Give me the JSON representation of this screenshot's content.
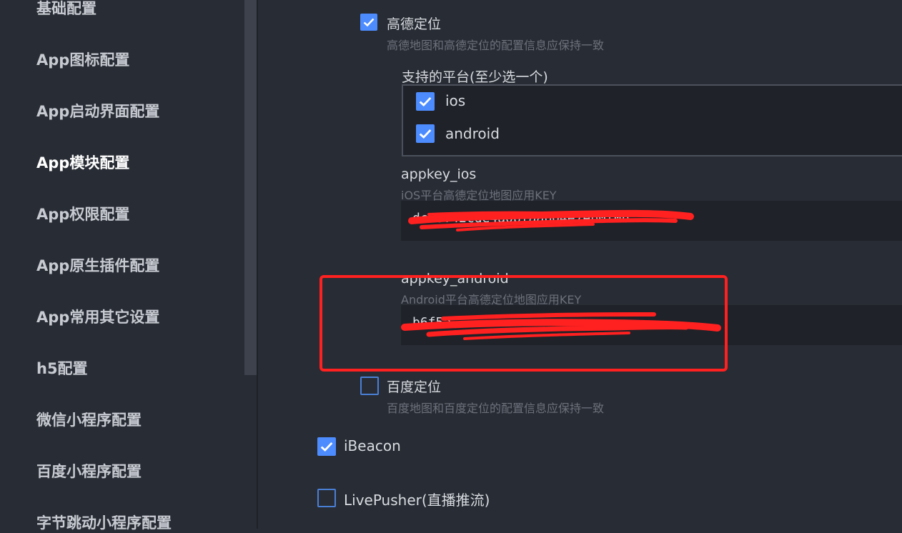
{
  "sidebar": {
    "items": [
      {
        "label": "基础配置"
      },
      {
        "label": "App图标配置"
      },
      {
        "label": "App启动界面配置"
      },
      {
        "label": "App模块配置"
      },
      {
        "label": "App权限配置"
      },
      {
        "label": "App原生插件配置"
      },
      {
        "label": "App常用其它设置"
      },
      {
        "label": "h5配置"
      },
      {
        "label": "微信小程序配置"
      },
      {
        "label": "百度小程序配置"
      },
      {
        "label": "字节跳动小程序配置"
      }
    ],
    "active_index": 3
  },
  "main": {
    "amap": {
      "label": "高德定位",
      "checked": true,
      "hint": "高德地图和高德定位的配置信息应保持一致",
      "platforms_label": "支持的平台(至少选一个)",
      "platforms": [
        {
          "label": "ios",
          "checked": true
        },
        {
          "label": "android",
          "checked": true
        }
      ],
      "appkey_ios": {
        "label": "appkey_ios",
        "hint": "iOS平台高德定位地图应用KEY",
        "value": "dc68f42cde4a0bfaab04e7eb0f0b"
      },
      "appkey_android": {
        "label": "appkey_android",
        "hint": "Android平台高德定位地图应用KEY",
        "value": "b6f5a"
      }
    },
    "baidu_location": {
      "label": "百度定位",
      "checked": false,
      "hint": "百度地图和百度定位的配置信息应保持一致"
    },
    "ibeacon": {
      "label": "iBeacon",
      "checked": true
    },
    "livepusher": {
      "label": "LivePusher(直播推流)",
      "checked": false
    }
  },
  "colors": {
    "background": "#282c34",
    "accent": "#4d8cff",
    "annotation": "#ff2020"
  }
}
